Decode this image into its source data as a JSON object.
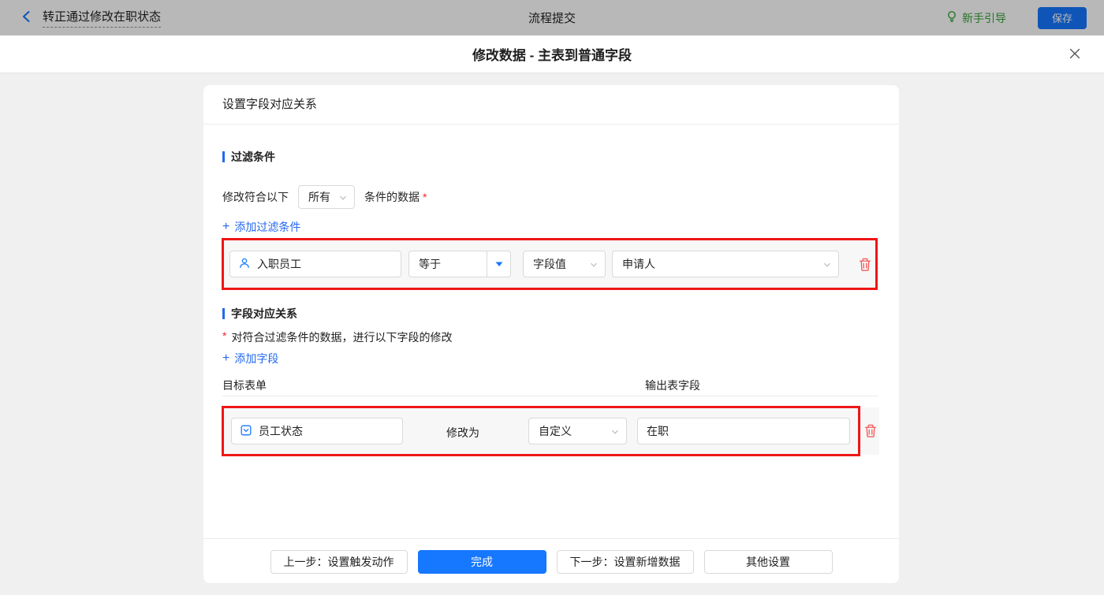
{
  "glyphs": {
    "plus": "+",
    "asterisk": "*"
  },
  "colors": {
    "accent_blue": "#1677ff",
    "link_blue": "#2468f2",
    "annotation_red": "#ee1616",
    "trash_red": "#f25b5b",
    "guide_green": "#36a13a",
    "row_grey": "#f7f7f7"
  },
  "topbar": {
    "back_title": "转正通过修改在职状态",
    "center_title": "流程提交",
    "guide_label": "新手引导",
    "save_label": "保存"
  },
  "modal": {
    "title": "修改数据 - 主表到普通字段"
  },
  "card": {
    "header": "设置字段对应关系",
    "filter_section": {
      "title": "过滤条件",
      "match_prefix": "修改符合以下",
      "match_select_value": "所有",
      "match_suffix": "条件的数据",
      "add_link": "添加过滤条件",
      "condition_row": {
        "field": "入职员工",
        "operator": "等于",
        "value_type": "字段值",
        "value": "申请人"
      }
    },
    "mapping_section": {
      "title": "字段对应关系",
      "description": "对符合过滤条件的数据，进行以下字段的修改",
      "add_link": "添加字段",
      "col_target": "目标表单",
      "col_output": "输出表字段",
      "row": {
        "field": "员工状态",
        "action_label": "修改为",
        "mode": "自定义",
        "value": "在职"
      }
    },
    "footer": {
      "prev_label": "上一步：设置触发动作",
      "done_label": "完成",
      "next_label": "下一步：设置新增数据",
      "other_label": "其他设置"
    }
  }
}
